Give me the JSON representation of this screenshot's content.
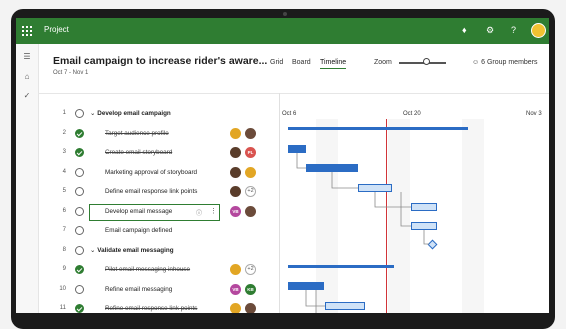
{
  "app": {
    "name": "Project"
  },
  "header": {
    "title": "Email campaign to increase rider's aware...",
    "dates": "Oct 7 - Nov 1",
    "views": [
      "Grid",
      "Board",
      "Timeline"
    ],
    "active_view": "Timeline",
    "zoom_label": "Zoom",
    "members": "6 Group members"
  },
  "timeline": {
    "dates": [
      "Oct 6",
      "Oct 20",
      "Nov 3"
    ]
  },
  "colors": {
    "brand": "#2f7d32",
    "bar": "#2b6cc4",
    "today": "#d13438"
  },
  "tasks": [
    {
      "num": "1",
      "name": "Develop email campaign",
      "group": true,
      "done": false
    },
    {
      "num": "2",
      "name": "Target audience profile",
      "done": true,
      "struck": true
    },
    {
      "num": "3",
      "name": "Create email storyboard",
      "done": true,
      "struck": true
    },
    {
      "num": "4",
      "name": "Marketing approval of storyboard",
      "done": false
    },
    {
      "num": "5",
      "name": "Define email response link points",
      "done": false,
      "extra": "+2"
    },
    {
      "num": "6",
      "name": "Develop email message",
      "done": false,
      "editing": true
    },
    {
      "num": "7",
      "name": "Email campaign defined",
      "done": false
    },
    {
      "num": "8",
      "name": "Validate email messaging",
      "group": true,
      "done": false
    },
    {
      "num": "9",
      "name": "Pilot email messaging inhouse",
      "done": true,
      "struck": true,
      "extra": "+2"
    },
    {
      "num": "10",
      "name": "Refine email messaging",
      "done": false
    },
    {
      "num": "11",
      "name": "Refine email response link points",
      "done": true,
      "struck": true
    }
  ],
  "avatars": {
    "r2": [
      {
        "initials": "",
        "color": "#e2a624"
      },
      {
        "initials": "",
        "color": "#6b4b3a"
      }
    ],
    "r3": [
      {
        "initials": "",
        "color": "#5a3d2b"
      },
      {
        "initials": "PL",
        "color": "#d9534f"
      }
    ],
    "r4": [
      {
        "initials": "",
        "color": "#5a3d2b"
      },
      {
        "initials": "",
        "color": "#e2a624"
      }
    ],
    "r5": [
      {
        "initials": "",
        "color": "#5a3d2b"
      }
    ],
    "r6": [
      {
        "initials": "VB",
        "color": "#b4489e"
      },
      {
        "initials": "",
        "color": "#6b4b3a"
      }
    ],
    "r9": [
      {
        "initials": "",
        "color": "#e2a624"
      }
    ],
    "r10": [
      {
        "initials": "VB",
        "color": "#b4489e"
      },
      {
        "initials": "KB",
        "color": "#2f7d32"
      }
    ],
    "r11": [
      {
        "initials": "",
        "color": "#e2a624"
      },
      {
        "initials": "",
        "color": "#6b4b3a"
      }
    ]
  }
}
